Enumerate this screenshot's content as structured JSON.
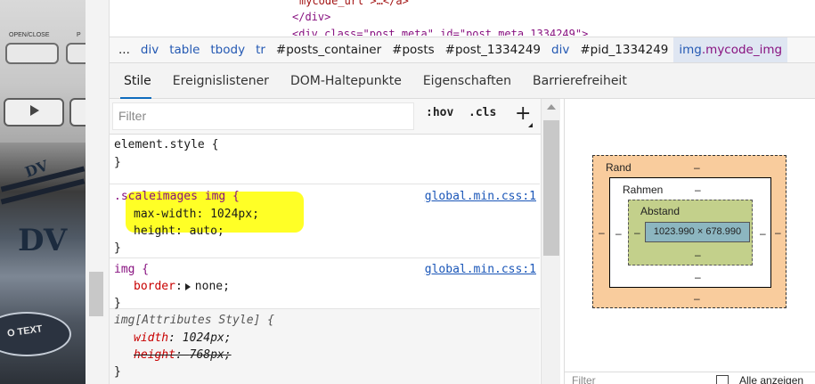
{
  "source": {
    "line1": "mycode_url\">…</a>",
    "line2": "</div>",
    "line3": "<div class=\"post_meta\" id=\"post_meta_1334249\">"
  },
  "photo": {
    "open_close_label": "OPEN/CLOSE",
    "p_label": "P",
    "dv_text": "DV",
    "dv_small": "DV",
    "otext": "O TEXT"
  },
  "breadcrumb": {
    "ellipsis": "...",
    "items": [
      "div",
      "table",
      "tbody",
      "tr",
      "#posts_container",
      "#posts",
      "#post_1334249",
      "div",
      "#pid_1334249"
    ],
    "selected_tag": "img",
    "selected_class": ".mycode_img"
  },
  "tabs": [
    "Stile",
    "Ereignislistener",
    "DOM-Haltepunkte",
    "Eigenschaften",
    "Barrierefreiheit"
  ],
  "filter": {
    "placeholder": "Filter",
    "hov": ":hov",
    "cls": ".cls",
    "plus": "+"
  },
  "rules": {
    "element_style": {
      "selector": "element.style {",
      "close": "}"
    },
    "scaleimages": {
      "selector_class": ".scaleimages",
      "selector_tag": " img {",
      "source": "global.min.css:1",
      "props": [
        {
          "name": "max-width",
          "value": "1024px;"
        },
        {
          "name": "height",
          "value": "auto;"
        }
      ],
      "close": "}"
    },
    "img": {
      "selector": "img {",
      "source": "global.min.css:1",
      "prop_name": "border",
      "prop_value": "none;",
      "close": "}"
    },
    "img_attr": {
      "selector": "img[Attributes Style] {",
      "props": [
        {
          "name": "width",
          "value": "1024px;"
        },
        {
          "name": "height",
          "value": "768px;"
        }
      ],
      "close": "}"
    }
  },
  "box_model": {
    "margin_label": "Rand",
    "border_label": "Rahmen",
    "padding_label": "Abstand",
    "content": "1023.990 × 678.990",
    "dash": "–"
  },
  "bottom": {
    "filter": "Filter",
    "show_all": "Alle anzeigen"
  },
  "colors": {
    "highlight": "#ffff1a",
    "margin": "#f9cc9d",
    "padding": "#c3d08b",
    "content": "#8cb6c0",
    "accent": "#0f6cbd"
  }
}
